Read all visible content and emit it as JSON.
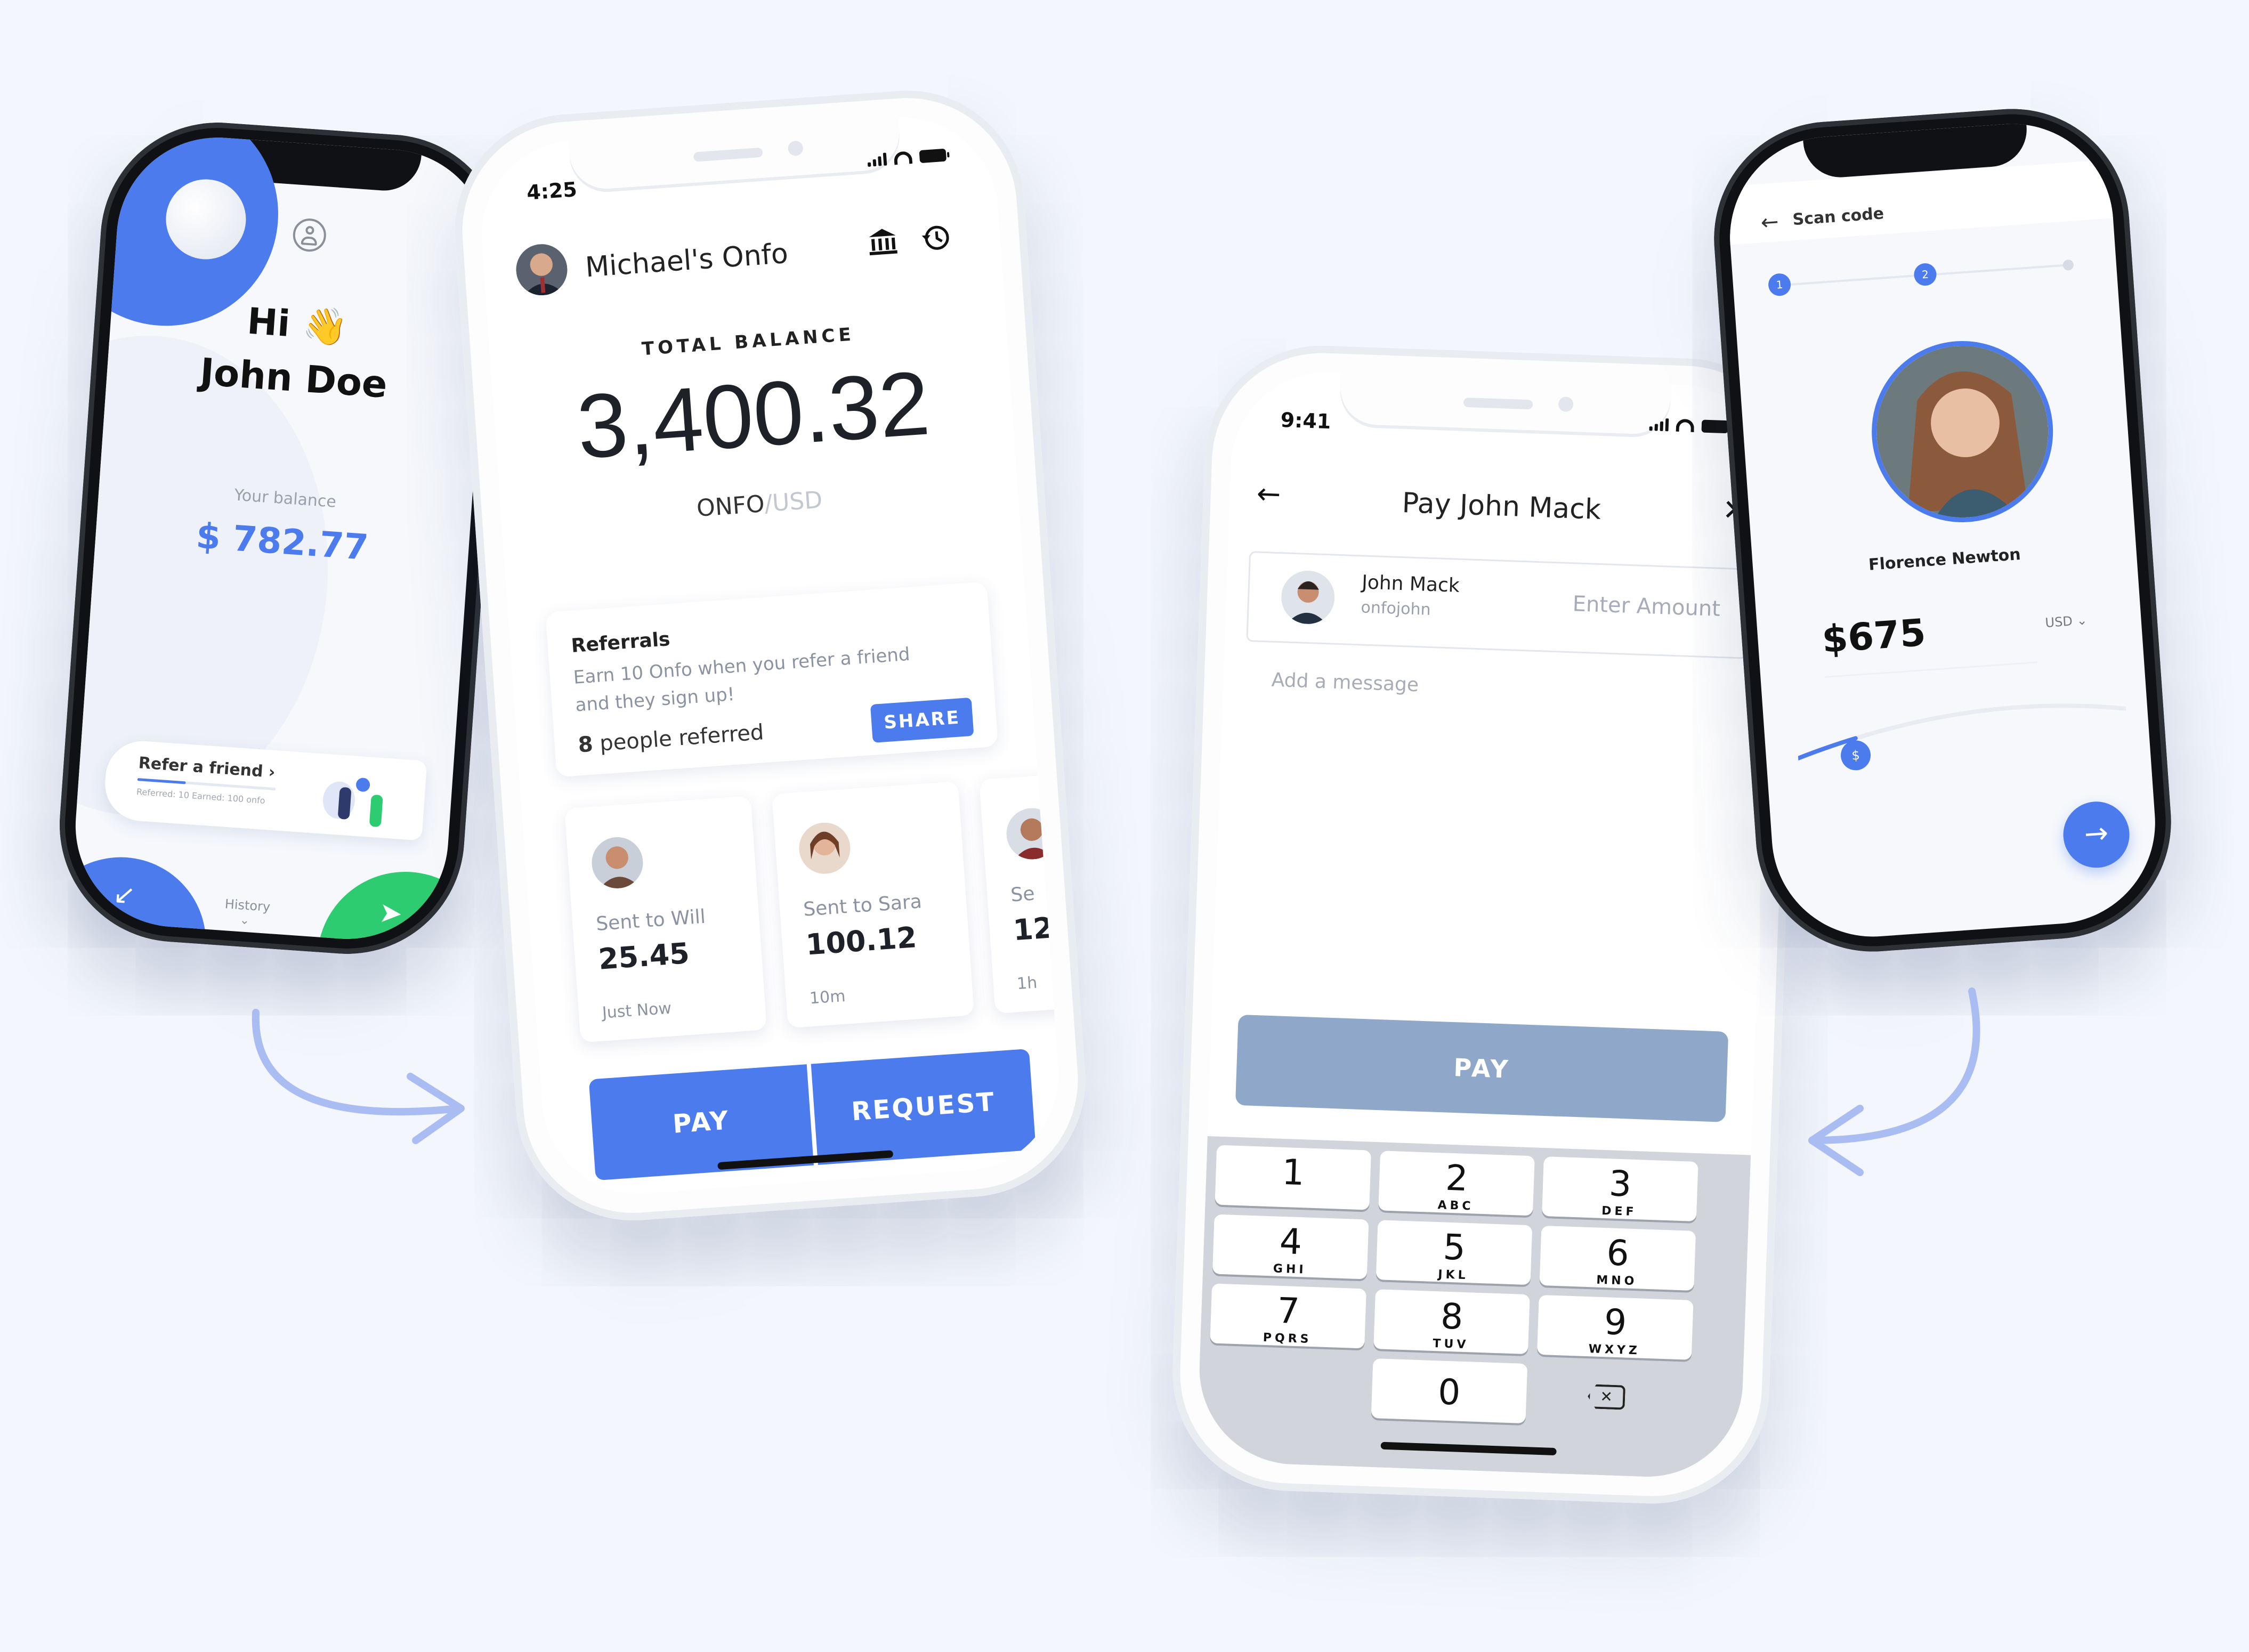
{
  "phone1": {
    "greeting": "Hi 👋",
    "name": "John Doe",
    "balance_label": "Your balance",
    "balance": "$ 782.77",
    "refer_title": "Refer a friend ›",
    "refer_sub": "Referred: 10  Earned: 100 onfo",
    "request_label": "Request",
    "history_label": "History",
    "send_label": "Send"
  },
  "phone2": {
    "time": "4:25",
    "account_name": "Michael's Onfo",
    "total_label": "TOTAL BALANCE",
    "total": "3,400.32",
    "currency_main": "ONFO",
    "currency_alt": "/USD",
    "ref_title": "Referrals",
    "ref_text": "Earn 10 Onfo when you refer a friend and they sign up!",
    "ref_count": "8",
    "ref_count_label": "people referred",
    "share": "SHARE",
    "tx": [
      {
        "label": "Sent to Will",
        "amount": "25.45",
        "time": "Just Now"
      },
      {
        "label": "Sent to Sara",
        "amount": "100.12",
        "time": "10m"
      },
      {
        "label": "Se",
        "amount": "12",
        "time": "1h"
      }
    ],
    "pay": "PAY",
    "request": "REQUEST"
  },
  "phone3": {
    "time": "9:41",
    "title": "Pay John Mack",
    "contact_name": "John Mack",
    "contact_handle": "onfojohn",
    "amount_placeholder": "Enter Amount",
    "message_placeholder": "Add a message",
    "pay": "PAY",
    "keys": [
      {
        "n": "1",
        "l": ""
      },
      {
        "n": "2",
        "l": "ABC"
      },
      {
        "n": "3",
        "l": "DEF"
      },
      {
        "n": "4",
        "l": "GHI"
      },
      {
        "n": "5",
        "l": "JKL"
      },
      {
        "n": "6",
        "l": "MNO"
      },
      {
        "n": "7",
        "l": "PQRS"
      },
      {
        "n": "8",
        "l": "TUV"
      },
      {
        "n": "9",
        "l": "WXYZ"
      },
      {
        "n": "0",
        "l": ""
      }
    ]
  },
  "phone4": {
    "back_label": "Scan code",
    "step_1": "1",
    "step_2": "2",
    "recipient": "Florence Newton",
    "amount": "$675",
    "currency": "USD",
    "slider_marker": "$"
  },
  "colors": {
    "accent": "#4b7bec",
    "green": "#2ecc71",
    "pay_disabled": "#8fa8c9",
    "arrow": "#a9bdf2"
  }
}
